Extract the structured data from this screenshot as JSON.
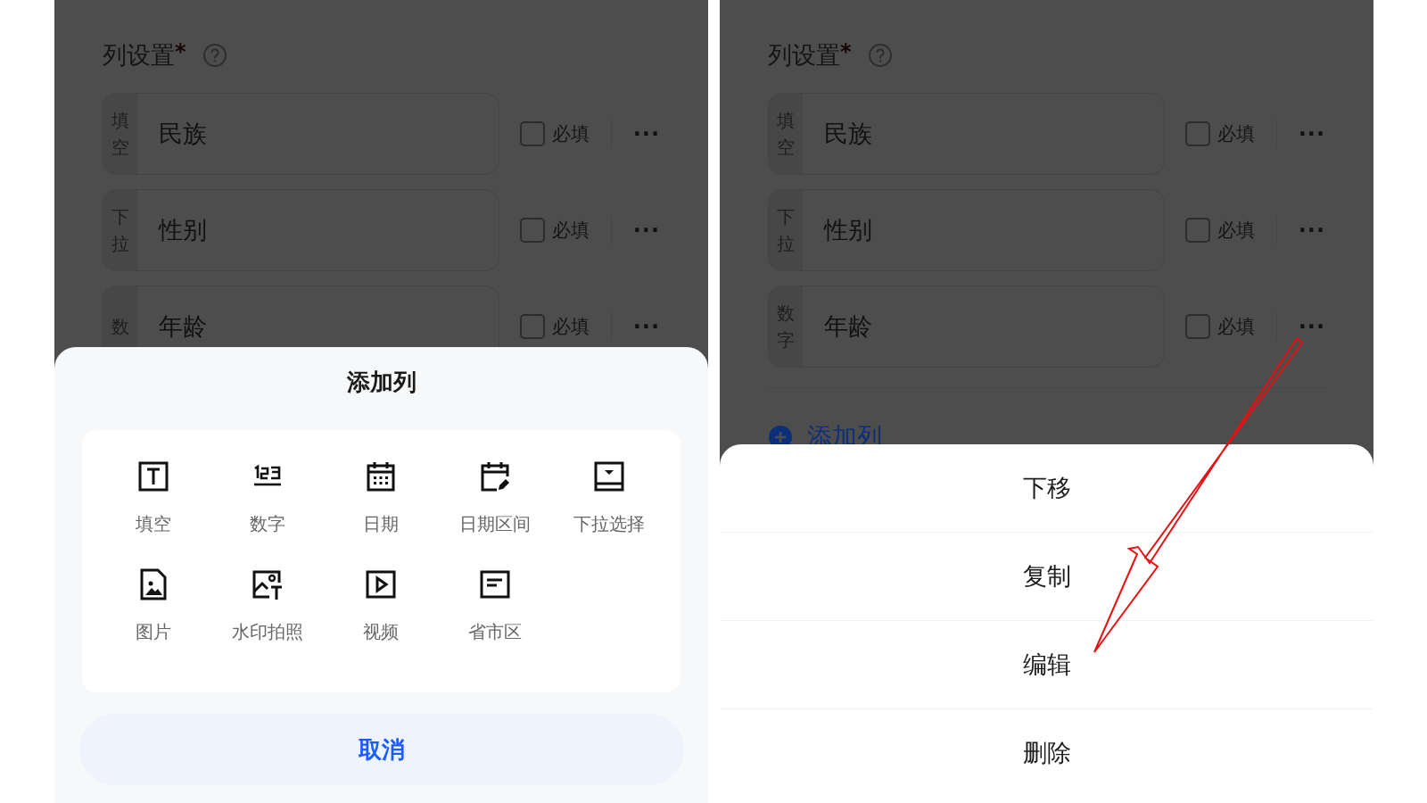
{
  "left_screen": {
    "section_title": "列设置",
    "required_mark": "*",
    "columns": [
      {
        "tag": "填空",
        "name": "民族",
        "required_label": "必填",
        "checked": false,
        "more": "···"
      },
      {
        "tag": "下拉",
        "name": "性别",
        "required_label": "必填",
        "checked": false,
        "more": "···"
      },
      {
        "tag": "数",
        "name": "年龄",
        "required_label": "必填",
        "checked": false,
        "more": "···"
      }
    ],
    "sheet": {
      "title": "添加列",
      "options": [
        {
          "kind": "text",
          "label": "填空"
        },
        {
          "kind": "number",
          "label": "数字"
        },
        {
          "kind": "date",
          "label": "日期"
        },
        {
          "kind": "daterange",
          "label": "日期区间"
        },
        {
          "kind": "dropdown",
          "label": "下拉选择"
        },
        {
          "kind": "image",
          "label": "图片"
        },
        {
          "kind": "watermark",
          "label": "水印拍照"
        },
        {
          "kind": "video",
          "label": "视频"
        },
        {
          "kind": "region",
          "label": "省市区"
        }
      ],
      "cancel": "取消"
    }
  },
  "right_screen": {
    "section_title": "列设置",
    "required_mark": "*",
    "columns": [
      {
        "tag": "填空",
        "name": "民族",
        "required_label": "必填",
        "checked": false,
        "more": "···"
      },
      {
        "tag": "下拉",
        "name": "性别",
        "required_label": "必填",
        "checked": false,
        "more": "···"
      },
      {
        "tag": "数字",
        "name": "年龄",
        "required_label": "必填",
        "checked": false,
        "more": "···"
      }
    ],
    "add_column": "添加列",
    "actions": [
      "下移",
      "复制",
      "编辑",
      "删除"
    ]
  }
}
